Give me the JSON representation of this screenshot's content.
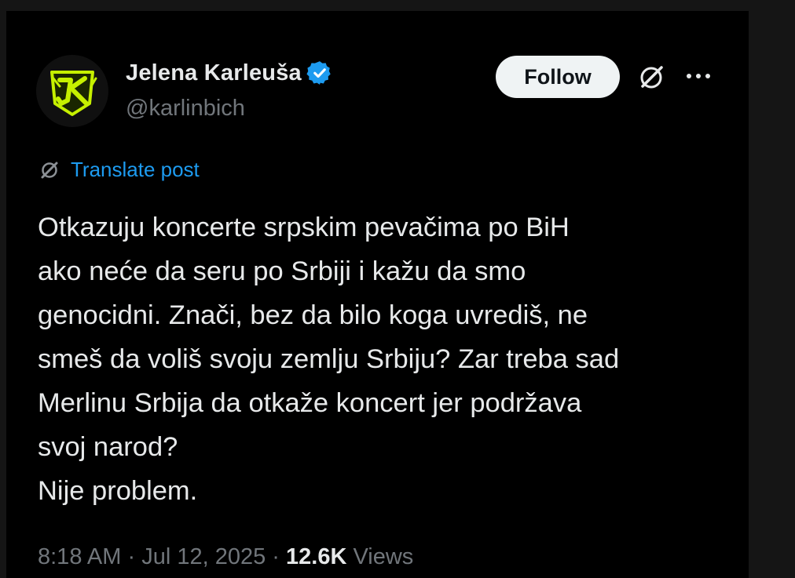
{
  "author": {
    "display_name": "Jelena Karleuša",
    "handle": "@karlinbich",
    "verified": true,
    "verified_color": "#1d9bf0",
    "avatar_icon": "jk-logo-icon"
  },
  "actions": {
    "follow_label": "Follow",
    "grok_icon": "grok-icon",
    "more_icon": "more-options-icon"
  },
  "translate": {
    "icon": "grok-icon",
    "label": "Translate post"
  },
  "post": {
    "lines": [
      "Otkazuju koncerte srpskim pevačima po BiH",
      "ako neće da seru po Srbiji i kažu da smo",
      "genocidni. Znači, bez da bilo koga uvrediš, ne",
      "smeš da voliš svoju zemlju Srbiju? Zar treba sad",
      "Merlinu Srbija da otkaže koncert jer podržava",
      "svoj narod?",
      "Nije problem."
    ]
  },
  "meta": {
    "time": "8:18 AM",
    "separator": "·",
    "date": "Jul 12, 2025",
    "views_count": "12.6K",
    "views_label": "Views"
  },
  "colors": {
    "background": "#000000",
    "text_primary": "#e7e9ea",
    "text_secondary": "#71767b",
    "accent": "#1d9bf0",
    "follow_bg": "#eff3f4",
    "avatar_neon": "#c6f000"
  }
}
